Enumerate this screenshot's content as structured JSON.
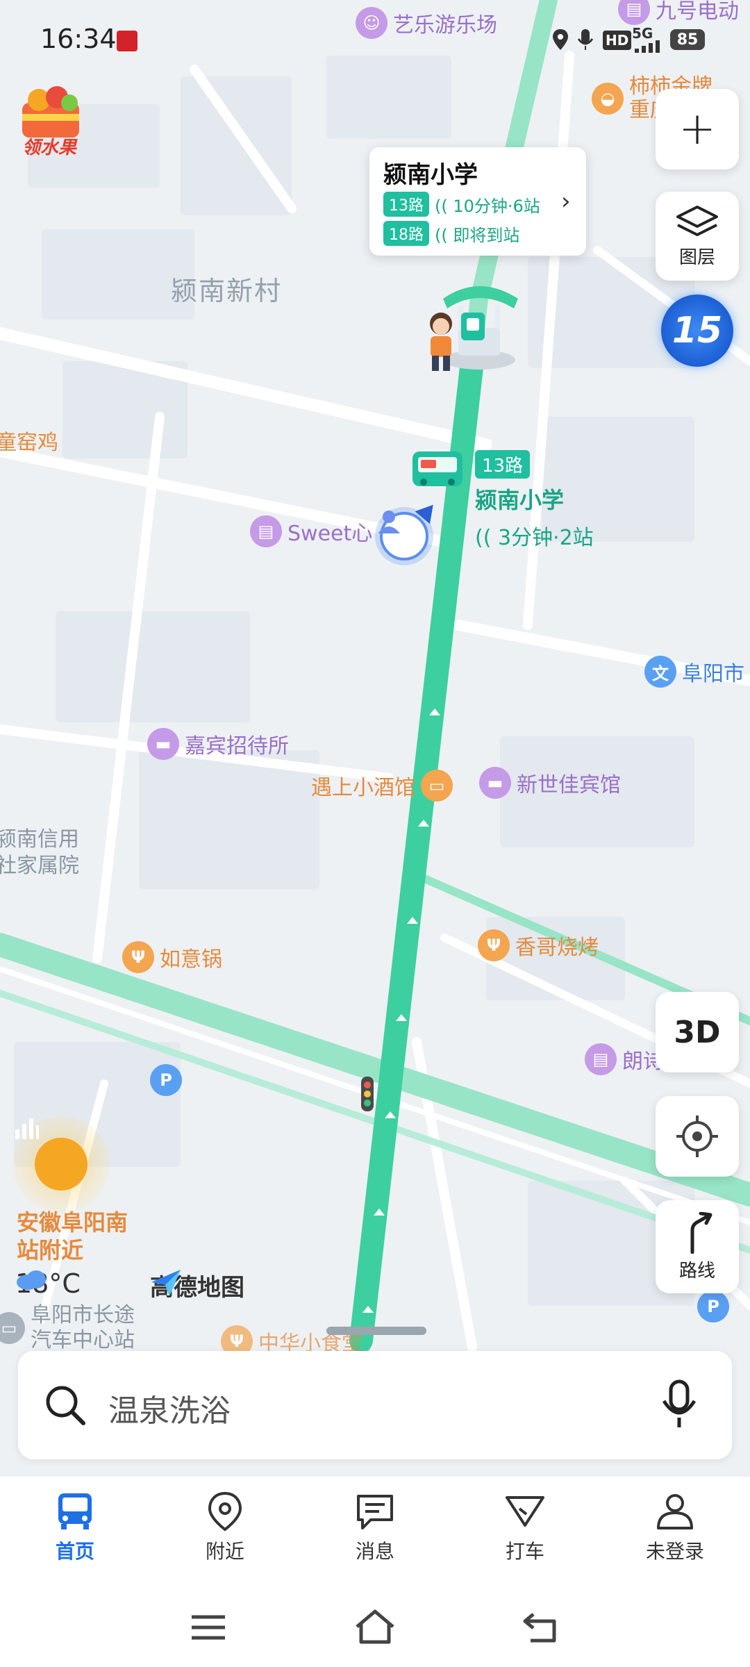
{
  "status_bar": {
    "time": "16:34",
    "battery": "85",
    "network": "5G",
    "hd": "HD"
  },
  "map": {
    "area_labels": {
      "yingnan_village": "颍南新村"
    },
    "pois": {
      "amusement": "艺乐游乐场",
      "store_top": "九号电动",
      "persimmon": "柿柿金牌重庆",
      "kiln_chicken": "童窑鸡",
      "sweet": "Sweet心",
      "fuyang_city": "阜阳市",
      "jiabin": "嘉宾招待所",
      "yushang": "遇上小酒馆",
      "xinshijia": "新世佳宾馆",
      "credit_coop": "颍南信用社家属院",
      "ruyi": "如意锅",
      "xiangge": "香哥烧烤",
      "langting": "朗诗",
      "bus_station": "阜阳市长途汽车中心站",
      "zhonghua": "中华小食堂"
    },
    "station_label": {
      "route": "13路",
      "stop": "颍南小学",
      "eta": "3分钟·2站"
    },
    "promo_label": "领水果",
    "location_label": "安徽阜阳南站附近",
    "weather": "18°C",
    "brand": "高德地图",
    "badge_15": "15"
  },
  "bus_card": {
    "title": "颍南小学",
    "routes": [
      {
        "route": "13路",
        "eta": "10分钟·6站"
      },
      {
        "route": "18路",
        "eta": "即将到站"
      }
    ]
  },
  "controls": {
    "zoom_in": "+",
    "layers": "图层",
    "mode_3d": "3D",
    "route": "路线"
  },
  "search": {
    "placeholder": "温泉洗浴"
  },
  "tabs": [
    {
      "label": "首页",
      "icon": "bus-icon",
      "active": true
    },
    {
      "label": "附近",
      "icon": "location-pin-icon",
      "active": false
    },
    {
      "label": "消息",
      "icon": "message-icon",
      "active": false
    },
    {
      "label": "打车",
      "icon": "taxi-icon",
      "active": false
    },
    {
      "label": "未登录",
      "icon": "user-icon",
      "active": false
    }
  ],
  "colors": {
    "accent": "#1e6fe8",
    "route_green": "#3dcf9f",
    "road_green": "#86e0bd"
  }
}
